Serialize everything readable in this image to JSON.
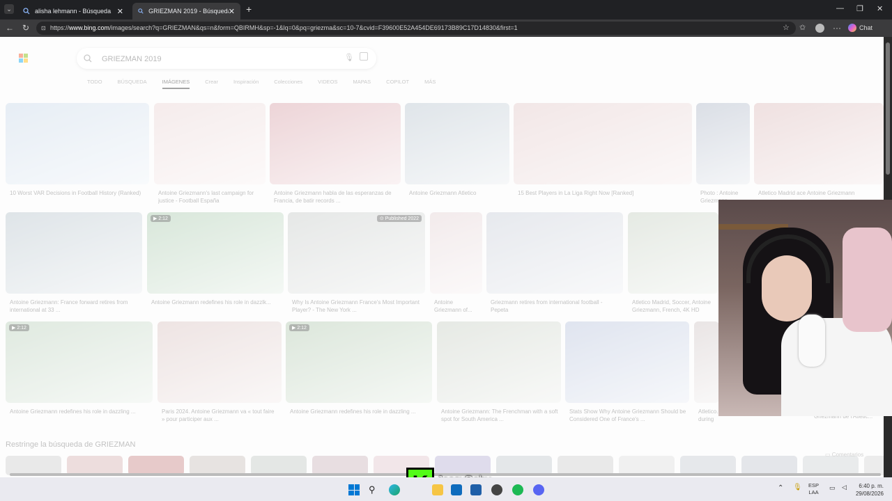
{
  "browser": {
    "tabs": [
      {
        "title": "alisha lehmann - Búsqueda",
        "active": false
      },
      {
        "title": "GRIEZMAN 2019 - Búsqueda Imág",
        "active": true
      }
    ],
    "url_prefix": "https://",
    "url_host": "www.bing.com",
    "url_path": "/images/search?q=GRIEZMAN&qs=n&form=QBIRMH&sp=-1&lq=0&pq=griezma&sc=10-7&cvid=F39600E52A454DE69173B89C17D14830&first=1",
    "chat_label": "Chat"
  },
  "search": {
    "query": "GRIEZMAN 2019"
  },
  "vertical_tabs": [
    "TODO",
    "BÚSQUEDA",
    "IMÁGENES",
    "Crear",
    "Inspiración",
    "Colecciones",
    "VIDEOS",
    "MAPAS",
    "COPILOT",
    "MÁS"
  ],
  "results": [
    {
      "caption": "10 Worst VAR Decisions in Football History (Ranked)",
      "color": "#c9d8e8"
    },
    {
      "caption": "Antoine Griezmann's last campaign for justice - Football España",
      "color": "#e9d4d4"
    },
    {
      "caption": "Antoine Griezmann habla de las esperanzas de Francia, de batir records ...",
      "color": "#d7a1a8"
    },
    {
      "caption": "Antoine Griezmann Atletico",
      "color": "#b9c5cf"
    },
    {
      "caption": "15 Best Players in La Liga Right Now [Ranked]",
      "color": "#e2c9c9"
    },
    {
      "caption": "Photo : Antoine Griezmann",
      "color": "#aeb7c7"
    },
    {
      "caption": "Atletico Madrid ace Antoine Griezmann",
      "color": "#dcbcbc"
    },
    {
      "caption": "Antoine Griezmann: France forward retires from international at 33 ...",
      "color": "#b7c4cc",
      "duration": ""
    },
    {
      "caption": "Antoine Griezmann redefines his role in dazzlk...",
      "color": "#a9c9ad",
      "duration": "2:12"
    },
    {
      "caption": "Why Is Antoine Griezmann France's Most Important Player? - The New York ...",
      "color": "#c7cbc9",
      "duration": "Published 2022"
    },
    {
      "caption": "Antoine Griezmann of...",
      "color": "#e3d2d4"
    },
    {
      "caption": "Griezmann retires from international football - Pepeta",
      "color": "#c9ced8"
    },
    {
      "caption": "Atletico Madrid, Soccer, Antoine Griezmann, French, 4K HD Wall...",
      "color": "#c6d0c2"
    },
    {
      "caption": "Antoine Griezmann redefines his role in dazzling ...",
      "color": "#b9cfba",
      "duration": "2:12"
    },
    {
      "caption": "Paris 2024. Antoine Griezmann va « tout faire » pour participer aux ...",
      "color": "#d9c3c1"
    },
    {
      "caption": "Antoine Griezmann redefines his role in dazzling ...",
      "color": "#b2c9b0",
      "duration": "2:12"
    },
    {
      "caption": "Antoine Griezmann: The Frenchman with a soft spot for South America ...",
      "color": "#c8cfc4"
    },
    {
      "caption": "Stats Show Why Antoine Griezmann Should be Considered One of France's ...",
      "color": "#b9c4dc"
    },
    {
      "caption": "Atletico... during the UEFA Champions League ...",
      "color": "#cfc5c5"
    },
    {
      "caption": "Griezmann de l'Atletic...",
      "color": "#d7cfcf"
    }
  ],
  "restrict_label": "Restringe la búsqueda de GRIEZMAN",
  "feedback_label": "Comentarios",
  "stream": {
    "name": "JessyBaby"
  },
  "taskbar": {
    "lang_top": "ESP",
    "lang_bottom": "LAA",
    "time": "6:40 p. m.",
    "date": "29/08/2026"
  }
}
